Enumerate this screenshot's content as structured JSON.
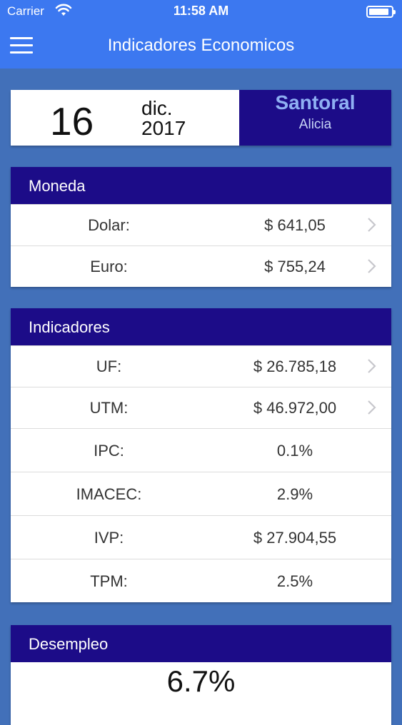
{
  "status_bar": {
    "carrier": "Carrier",
    "time": "11:58 AM",
    "battery_level_percent": 90
  },
  "nav": {
    "title": "Indicadores Economicos"
  },
  "date_card": {
    "day": "16",
    "month": "dic.",
    "year": "2017",
    "santoral_label": "Santoral",
    "santoral_name": "Alicia"
  },
  "moneda": {
    "title": "Moneda",
    "rows": [
      {
        "label": "Dolar:",
        "value": "$ 641,05"
      },
      {
        "label": "Euro:",
        "value": "$ 755,24"
      }
    ]
  },
  "indicadores": {
    "title": "Indicadores",
    "rows": [
      {
        "label": "UF:",
        "value": "$ 26.785,18"
      },
      {
        "label": "UTM:",
        "value": "$ 46.972,00"
      },
      {
        "label": "IPC:",
        "value": "0.1%"
      },
      {
        "label": "IMACEC:",
        "value": "2.9%"
      },
      {
        "label": "IVP:",
        "value": "$ 27.904,55"
      },
      {
        "label": "TPM:",
        "value": "2.5%"
      }
    ]
  },
  "desempleo": {
    "title": "Desempleo",
    "value": "6.7%"
  },
  "colors": {
    "nav_blue": "#3c78f0",
    "background": "#4270b9",
    "header_navy": "#1c0c88",
    "santoral_label": "#8fb0f3"
  }
}
